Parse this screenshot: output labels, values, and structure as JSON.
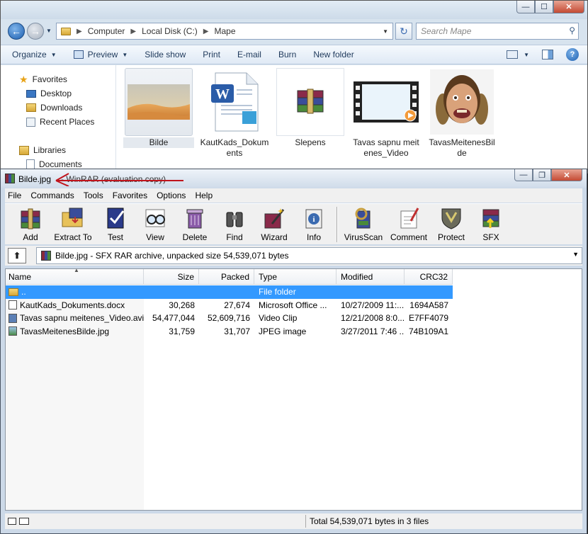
{
  "explorer": {
    "breadcrumb": [
      "Computer",
      "Local Disk (C:)",
      "Mape"
    ],
    "search_placeholder": "Search Mape",
    "toolbar": [
      "Organize",
      "Preview",
      "Slide show",
      "Print",
      "E-mail",
      "Burn",
      "New folder"
    ],
    "nav": {
      "favorites": "Favorites",
      "desktop": "Desktop",
      "downloads": "Downloads",
      "recent": "Recent Places",
      "libraries": "Libraries",
      "documents": "Documents"
    },
    "files": [
      {
        "name": "Bilde",
        "icon": "image-thumbnail"
      },
      {
        "name": "KautKads_Dokuments",
        "icon": "word-document-icon"
      },
      {
        "name": "Slepens",
        "icon": "winrar-archive-icon"
      },
      {
        "name": "Tavas sapnu meitenes_Video",
        "icon": "video-thumbnail"
      },
      {
        "name": "TavasMeitenesBilde",
        "icon": "photo-thumbnail"
      }
    ]
  },
  "rar": {
    "title_main": "Bilde.jpg",
    "title_rest": "- WinRAR (evaluation copy)",
    "menu": [
      "File",
      "Commands",
      "Tools",
      "Favorites",
      "Options",
      "Help"
    ],
    "toolbar": [
      "Add",
      "Extract To",
      "Test",
      "View",
      "Delete",
      "Find",
      "Wizard",
      "Info",
      "VirusScan",
      "Comment",
      "Protect",
      "SFX"
    ],
    "path": "Bilde.jpg - SFX RAR archive, unpacked size 54,539,071 bytes",
    "columns": {
      "name": "Name",
      "size": "Size",
      "packed": "Packed",
      "type": "Type",
      "modified": "Modified",
      "crc": "CRC32"
    },
    "rows": [
      {
        "name": "..",
        "size": "",
        "packed": "",
        "type": "File folder",
        "modified": "",
        "crc": ""
      },
      {
        "name": "KautKads_Dokuments.docx",
        "size": "30,268",
        "packed": "27,674",
        "type": "Microsoft Office ...",
        "modified": "10/27/2009 11:...",
        "crc": "1694A587"
      },
      {
        "name": "Tavas sapnu meitenes_Video.avi",
        "size": "54,477,044",
        "packed": "52,609,716",
        "type": "Video Clip",
        "modified": "12/21/2008 8:0...",
        "crc": "E7FF4079"
      },
      {
        "name": "TavasMeitenesBilde.jpg",
        "size": "31,759",
        "packed": "31,707",
        "type": "JPEG image",
        "modified": "3/27/2011 7:46 ...",
        "crc": "74B109A1"
      }
    ],
    "status": "Total 54,539,071 bytes in 3 files"
  },
  "colors": {
    "selection": "#3399ff",
    "annotation_arrow": "#c0141c"
  }
}
